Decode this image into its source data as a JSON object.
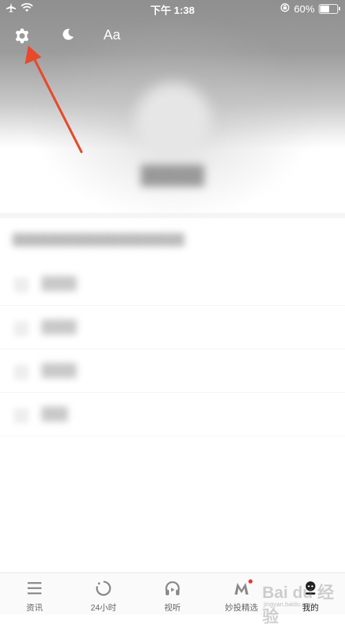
{
  "status_bar": {
    "time": "下午 1:38",
    "battery": "60%",
    "battery_level": 0.6
  },
  "toolbar": {
    "settings_icon": "gear-icon",
    "night_icon": "moon-icon",
    "font_label": "Aa"
  },
  "tabs": [
    {
      "label": "资讯",
      "icon": "list-icon"
    },
    {
      "label": "24小时",
      "icon": "refresh-icon"
    },
    {
      "label": "视听",
      "icon": "headphones-icon"
    },
    {
      "label": "妙投精选",
      "icon": "m-logo-icon"
    },
    {
      "label": "我的",
      "icon": "profile-icon"
    }
  ],
  "watermark": {
    "text": "Bai du 经验",
    "sub": "jingyan.baidu.com"
  },
  "colors": {
    "arrow": "#e8492c",
    "badge": "#e33333"
  }
}
